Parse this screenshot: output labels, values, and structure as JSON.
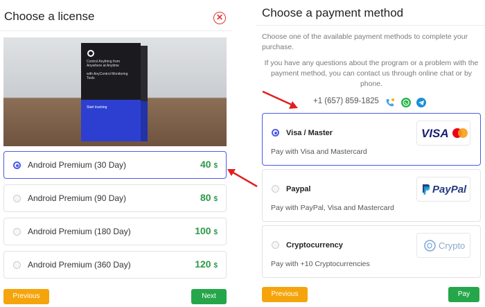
{
  "license": {
    "title": "Choose a license",
    "close_glyph": "✕",
    "product_box": {
      "text": "Control Anything from Anywhere at Anytime",
      "subtext": "with AnyControl Monitoring Tools",
      "start": "Start tracking"
    },
    "items": [
      {
        "label": "Android Premium (30 Day)",
        "price": "40",
        "currency": "$",
        "selected": true
      },
      {
        "label": "Android Premium (90 Day)",
        "price": "80",
        "currency": "$",
        "selected": false
      },
      {
        "label": "Android Premium (180 Day)",
        "price": "100",
        "currency": "$",
        "selected": false
      },
      {
        "label": "Android Premium (360 Day)",
        "price": "120",
        "currency": "$",
        "selected": false
      }
    ],
    "previous_label": "Previous",
    "next_label": "Next"
  },
  "payment": {
    "title": "Choose a payment method",
    "desc1": "Choose one of the available payment methods to complete your purchase.",
    "desc2": "If you have any questions about the program or a problem with the payment method, you can contact us through online chat or by phone.",
    "phone": "+1 (657) 859-1825",
    "contact_icons": [
      "phone-icon",
      "whatsapp-icon",
      "telegram-icon"
    ],
    "methods": [
      {
        "name": "Visa / Master",
        "desc": "Pay with Visa and Mastercard",
        "logo": "VISA",
        "selected": true
      },
      {
        "name": "Paypal",
        "desc": "Pay with PayPal, Visa and Mastercard",
        "logo": "PayPal",
        "selected": false
      },
      {
        "name": "Cryptocurrency",
        "desc": "Pay with +10 Cryptocurrencies",
        "logo": "Crypto",
        "selected": false
      }
    ],
    "previous_label": "Previous",
    "pay_label": "Pay"
  },
  "colors": {
    "accent": "#4a5be8",
    "price_green": "#2a9a48",
    "orange_button": "#f5a40c",
    "green_button": "#26a64a",
    "close_red": "#e0342f",
    "arrow_red": "#e21f1f"
  }
}
